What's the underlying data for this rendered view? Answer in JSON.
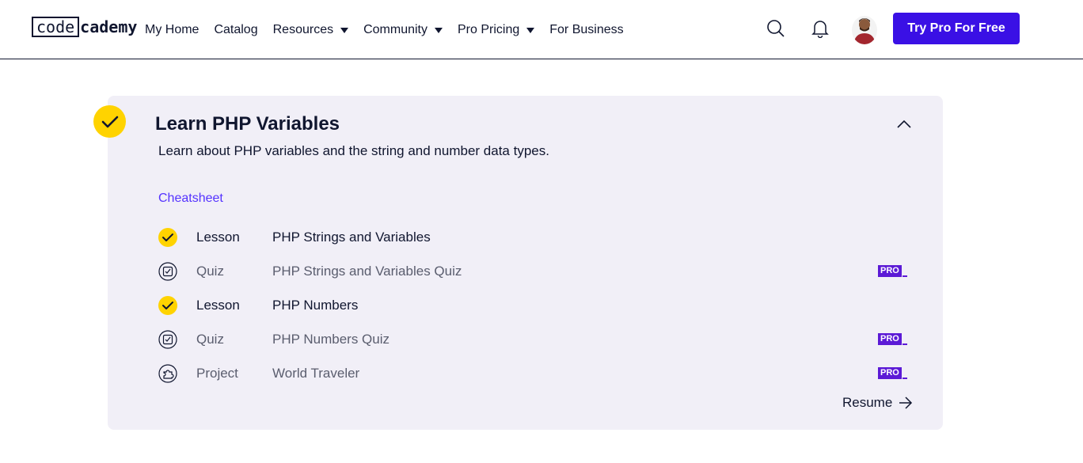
{
  "header": {
    "logo": {
      "boxed": "code",
      "rest": "cademy"
    },
    "nav": [
      {
        "label": "My Home",
        "dropdown": false
      },
      {
        "label": "Catalog",
        "dropdown": false
      },
      {
        "label": "Resources",
        "dropdown": true
      },
      {
        "label": "Community",
        "dropdown": true
      },
      {
        "label": "Pro Pricing",
        "dropdown": true
      },
      {
        "label": "For Business",
        "dropdown": false
      }
    ],
    "icons": {
      "search": "search-icon",
      "notifications": "bell-icon",
      "avatar": "user-avatar"
    },
    "cta_label": "Try Pro For Free",
    "cta_color": "#3a10e5"
  },
  "module": {
    "completed": true,
    "badge_color": "#ffd300",
    "title": "Learn PHP Variables",
    "description": "Learn about PHP variables and the string and number data types.",
    "cheatsheet_label": "Cheatsheet",
    "items": [
      {
        "type": "Lesson",
        "name": "PHP Strings and Variables",
        "status": "completed",
        "icon": "check-icon",
        "pro": false
      },
      {
        "type": "Quiz",
        "name": "PHP Strings and Variables Quiz",
        "status": "not-started",
        "icon": "quiz-icon",
        "pro": true
      },
      {
        "type": "Lesson",
        "name": "PHP Numbers",
        "status": "completed",
        "icon": "check-icon",
        "pro": false
      },
      {
        "type": "Quiz",
        "name": "PHP Numbers Quiz",
        "status": "not-started",
        "icon": "quiz-icon",
        "pro": true
      },
      {
        "type": "Project",
        "name": "World Traveler",
        "status": "not-started",
        "icon": "project-icon",
        "pro": true
      }
    ],
    "pro_label": "PRO",
    "resume_label": "Resume"
  }
}
